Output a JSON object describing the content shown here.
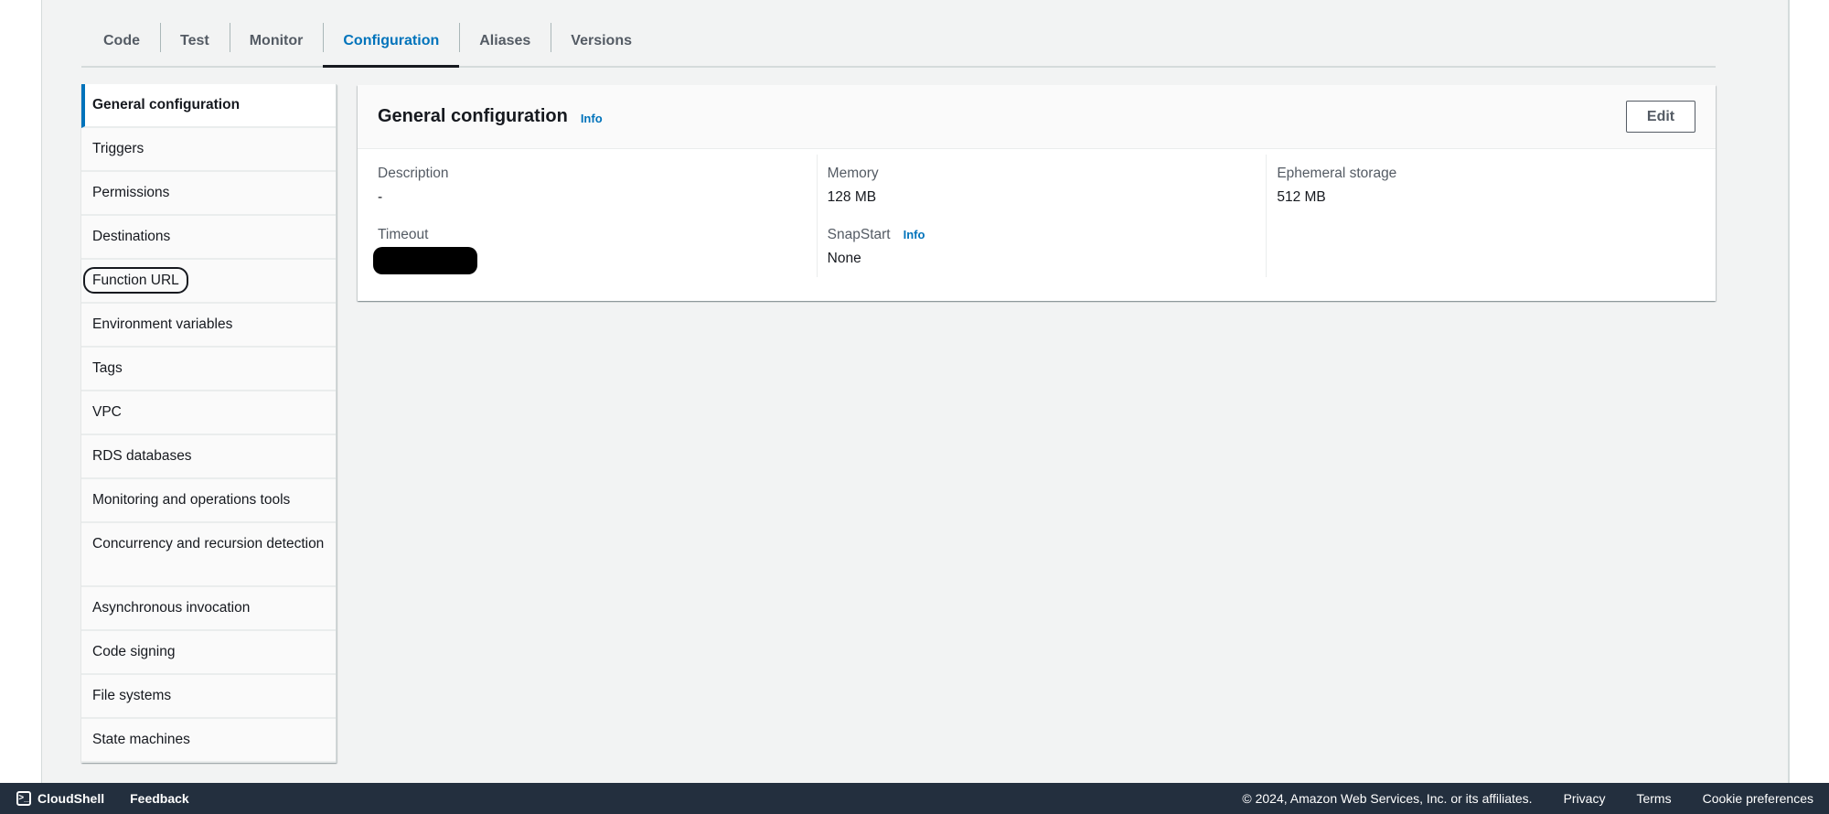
{
  "tabs": [
    {
      "label": "Code",
      "active": false
    },
    {
      "label": "Test",
      "active": false
    },
    {
      "label": "Monitor",
      "active": false
    },
    {
      "label": "Configuration",
      "active": true
    },
    {
      "label": "Aliases",
      "active": false
    },
    {
      "label": "Versions",
      "active": false
    }
  ],
  "sidenav": {
    "items": [
      {
        "label": "General configuration"
      },
      {
        "label": "Triggers"
      },
      {
        "label": "Permissions"
      },
      {
        "label": "Destinations"
      },
      {
        "label": "Function URL"
      },
      {
        "label": "Environment variables"
      },
      {
        "label": "Tags"
      },
      {
        "label": "VPC"
      },
      {
        "label": "RDS databases"
      },
      {
        "label": "Monitoring and operations tools"
      },
      {
        "label": "Concurrency and recursion detection"
      },
      {
        "label": "Asynchronous invocation"
      },
      {
        "label": "Code signing"
      },
      {
        "label": "File systems"
      },
      {
        "label": "State machines"
      }
    ],
    "active_index": 0,
    "focused_index": 4
  },
  "panel": {
    "title": "General configuration",
    "info_label": "Info",
    "edit_label": "Edit",
    "fields": {
      "description": {
        "label": "Description",
        "value": "-"
      },
      "timeout": {
        "label": "Timeout",
        "value_redacted": true
      },
      "memory": {
        "label": "Memory",
        "value": "128  MB"
      },
      "snapstart": {
        "label": "SnapStart",
        "info_label": "Info",
        "value": "None"
      },
      "ephemeral_storage": {
        "label": "Ephemeral storage",
        "value": "512  MB"
      }
    }
  },
  "footer": {
    "cloudshell_label": "CloudShell",
    "cloudshell_icon": "terminal-icon",
    "feedback_label": "Feedback",
    "copyright": "© 2024, Amazon Web Services, Inc. or its affiliates.",
    "links": [
      "Privacy",
      "Terms",
      "Cookie preferences"
    ]
  },
  "colors": {
    "accent": "#0073bb",
    "footer_bg": "#232f3e",
    "page_bg": "#f2f3f3"
  }
}
